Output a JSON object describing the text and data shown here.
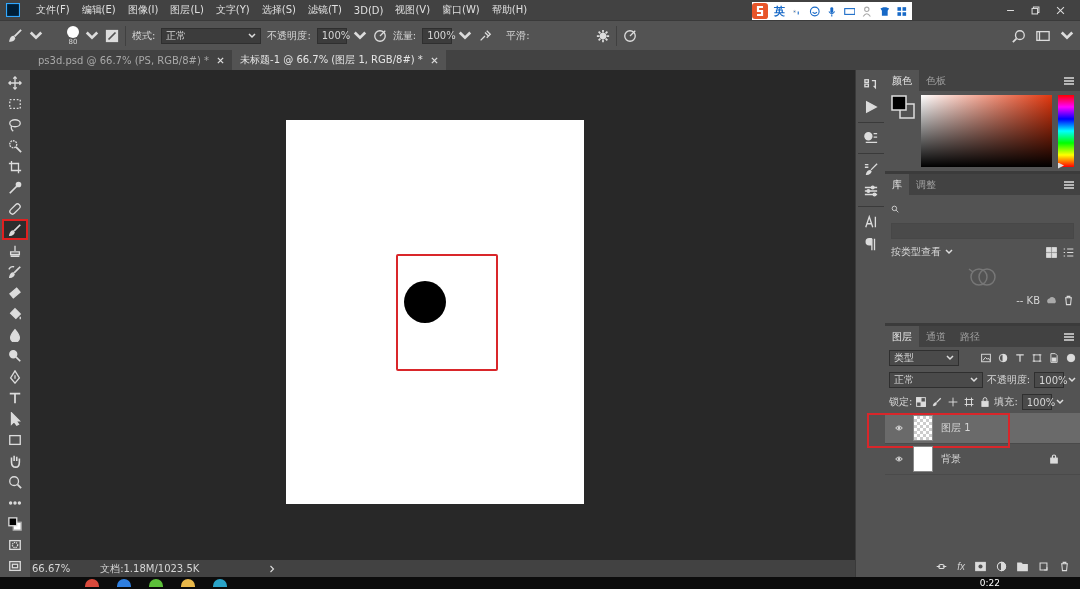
{
  "menu": [
    "文件(F)",
    "编辑(E)",
    "图像(I)",
    "图层(L)",
    "文字(Y)",
    "选择(S)",
    "滤镜(T)",
    "3D(D)",
    "视图(V)",
    "窗口(W)",
    "帮助(H)"
  ],
  "ime_bar": {
    "label": "英"
  },
  "options": {
    "brush_size": "80",
    "mode_label": "模式:",
    "mode": "正常",
    "opacity_label": "不透明度:",
    "opacity": "100%",
    "flow_label": "流量:",
    "flow": "100%",
    "smoothing_label": "平滑:"
  },
  "doc_tabs": [
    {
      "label": "ps3d.psd @ 66.7% (PS, RGB/8#) *",
      "selected": false
    },
    {
      "label": "未标题-1 @ 66.7% (图层 1, RGB/8#) *",
      "selected": true
    }
  ],
  "tools": [
    {
      "kind": "move",
      "selected": false
    },
    {
      "kind": "marquee",
      "selected": false
    },
    {
      "kind": "lasso",
      "selected": false
    },
    {
      "kind": "quick",
      "selected": false
    },
    {
      "kind": "crop",
      "selected": false
    },
    {
      "kind": "eyedropper",
      "selected": false
    },
    {
      "kind": "healing",
      "selected": false
    },
    {
      "kind": "brush",
      "selected": true,
      "highlighted": true
    },
    {
      "kind": "stamp",
      "selected": false
    },
    {
      "kind": "history",
      "selected": false
    },
    {
      "kind": "eraser",
      "selected": false
    },
    {
      "kind": "bucket",
      "selected": false
    },
    {
      "kind": "blur",
      "selected": false
    },
    {
      "kind": "dodge",
      "selected": false
    },
    {
      "kind": "pen",
      "selected": false
    },
    {
      "kind": "type",
      "selected": false
    },
    {
      "kind": "pathselect",
      "selected": false
    },
    {
      "kind": "rect",
      "selected": false
    },
    {
      "kind": "hand",
      "selected": false
    },
    {
      "kind": "zoom",
      "selected": false
    },
    {
      "kind": "more",
      "selected": false
    },
    {
      "kind": "colors",
      "selected": false
    },
    {
      "kind": "mask",
      "selected": false
    },
    {
      "kind": "screen",
      "selected": false
    }
  ],
  "canvas": {
    "marker": true
  },
  "color_panel": {
    "tabs": [
      {
        "label": "颜色",
        "selected": true
      },
      {
        "label": "色板",
        "selected": false
      }
    ],
    "hue": {
      "level": 0.02
    }
  },
  "library_panel": {
    "tabs": [
      {
        "label": "库",
        "selected": true
      },
      {
        "label": "调整",
        "selected": false
      }
    ],
    "view_label": "按类型查看",
    "size": "-- KB"
  },
  "layers_panel": {
    "tabs": [
      {
        "label": "图层",
        "selected": true
      },
      {
        "label": "通道",
        "selected": false
      },
      {
        "label": "路径",
        "selected": false
      }
    ],
    "filter": "类型",
    "blend": "正常",
    "opacity_label": "不透明度:",
    "opacity": "100%",
    "lock_label": "锁定:",
    "fill_label": "填充:",
    "fill": "100%",
    "fx_label": "fx",
    "layers": [
      {
        "name": "图层 1",
        "kind": "transparent",
        "visible": true,
        "selected": true,
        "highlighted": true,
        "locked": false
      },
      {
        "name": "背景",
        "kind": "white",
        "visible": true,
        "selected": false,
        "highlighted": false,
        "locked": true
      }
    ]
  },
  "status_bar": {
    "zoom": "66.67%",
    "doc": "文档:1.18M/1023.5K"
  },
  "taskbar": {
    "time": "0:22"
  }
}
